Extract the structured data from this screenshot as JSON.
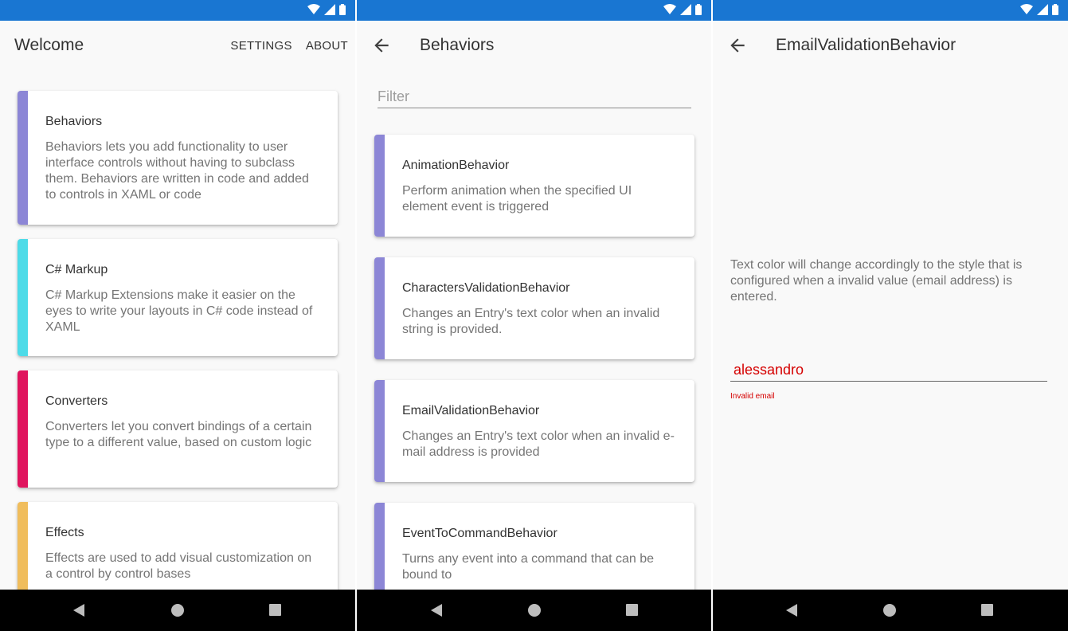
{
  "colors": {
    "status_bar": "#1976d2",
    "stripe_purple": "#8c86d6",
    "stripe_cyan": "#4ddbe8",
    "stripe_pink": "#e0145e",
    "stripe_yellow": "#f0bd5c",
    "error_red": "#d50000"
  },
  "screen1": {
    "title": "Welcome",
    "actions": [
      "SETTINGS",
      "ABOUT"
    ],
    "cards": [
      {
        "title": "Behaviors",
        "description": "Behaviors lets you add functionality to user interface controls without having to subclass them. Behaviors are written in code and added to controls in XAML or code",
        "stripe": "#8c86d6"
      },
      {
        "title": "C# Markup",
        "description": "C# Markup Extensions make it easier on the eyes to write your layouts in C# code instead of XAML",
        "stripe": "#4ddbe8"
      },
      {
        "title": "Converters",
        "description": "Converters let you convert bindings of a certain type to a different value, based on custom logic",
        "stripe": "#e0145e"
      },
      {
        "title": "Effects",
        "description": "Effects are used to add visual customization on a control by control bases",
        "stripe": "#f0bd5c"
      }
    ]
  },
  "screen2": {
    "title": "Behaviors",
    "back_icon": "arrow-left-icon",
    "filter_placeholder": "Filter",
    "cards": [
      {
        "title": "AnimationBehavior",
        "description": "Perform animation when the specified UI element event is triggered",
        "stripe": "#8c86d6"
      },
      {
        "title": "CharactersValidationBehavior",
        "description": "Changes an Entry's text color when an invalid string is provided.",
        "stripe": "#8c86d6"
      },
      {
        "title": "EmailValidationBehavior",
        "description": "Changes an Entry's text color when an invalid e-mail address is provided",
        "stripe": "#8c86d6"
      },
      {
        "title": "EventToCommandBehavior",
        "description": "Turns any event into a command that can be bound to",
        "stripe": "#8c86d6"
      }
    ]
  },
  "screen3": {
    "title": "EmailValidationBehavior",
    "back_icon": "arrow-left-icon",
    "description": "Text color will change accordingly to the style that is configured when a invalid value (email address) is entered.",
    "entry_value": "alessandro",
    "error_text": "Invalid email"
  },
  "status_icons": [
    "wifi-icon",
    "signal-icon",
    "battery-icon"
  ],
  "nav_icons": [
    "nav-back-icon",
    "nav-home-icon",
    "nav-recent-icon"
  ]
}
